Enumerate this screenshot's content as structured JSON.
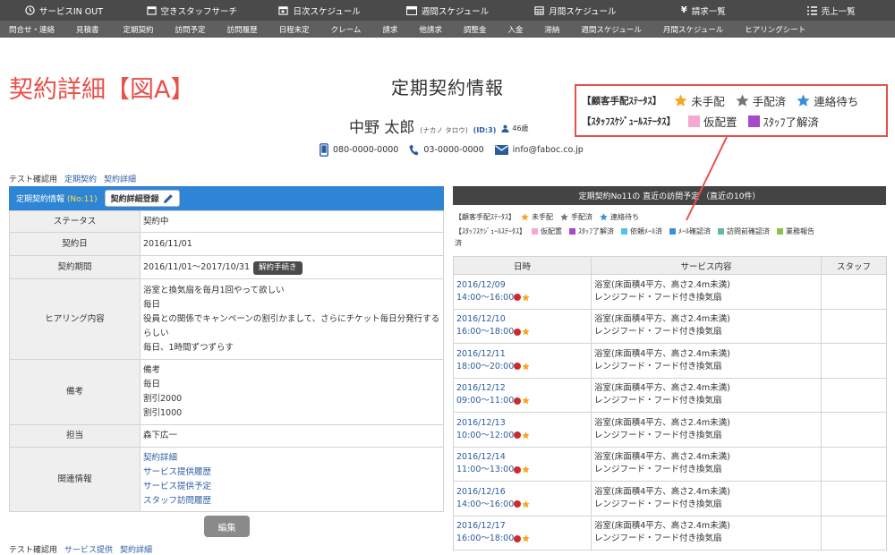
{
  "nav": {
    "top": [
      {
        "label": "サービスIN OUT",
        "icon": "clock-icon"
      },
      {
        "label": "空きスタッフサーチ",
        "icon": "calendar-icon"
      },
      {
        "label": "日次スケジュール",
        "icon": "calendar-icon"
      },
      {
        "label": "週間スケジュール",
        "icon": "week-icon"
      },
      {
        "label": "月間スケジュール",
        "icon": "calendar-icon"
      },
      {
        "label": "請求一覧",
        "icon": "yen-icon"
      },
      {
        "label": "売上一覧",
        "icon": "list-icon"
      }
    ],
    "sub": [
      "問合せ・連絡",
      "見積書",
      "定期契約",
      "訪問予定",
      "訪問履歴",
      "日程未定",
      "クレーム",
      "請求",
      "他請求",
      "調整金",
      "入金",
      "滞納",
      "週間スケジュール",
      "月間スケジュール",
      "ヒアリングシート"
    ]
  },
  "annotation": {
    "title": "契約詳細【図A】",
    "callout": {
      "customer_label": "【顧客手配ｽﾃｰﾀｽ】",
      "customer_items": [
        {
          "label": "未手配",
          "color": "#f5a623"
        },
        {
          "label": "手配済",
          "color": "#777777"
        },
        {
          "label": "連絡待ち",
          "color": "#3a8fd8"
        }
      ],
      "staff_label": "【ｽﾀｯﾌｽｹｼﾞｭｰﾙｽﾃｰﾀｽ】",
      "staff_items": [
        {
          "label": "仮配置",
          "color": "#f5a9d0"
        },
        {
          "label": "ｽﾀｯﾌ了解済",
          "color": "#a64ac9"
        }
      ]
    }
  },
  "page": {
    "title": "定期契約情報"
  },
  "customer": {
    "name": "中野 太郎",
    "kana": "(ナカノ タロウ)",
    "id": "(ID:3)",
    "age": "46歳",
    "mobile": "080-0000-0000",
    "phone": "03-0000-0000",
    "email": "info@faboc.co.jp"
  },
  "breadcrumb": {
    "prefix": "テスト確認用",
    "links": [
      "定期契約",
      "契約詳細"
    ]
  },
  "breadcrumb_bottom": {
    "prefix": "テスト確認用",
    "links": [
      "サービス提供",
      "契約詳細"
    ]
  },
  "contract": {
    "header_title": "定期契約情報",
    "header_no": "(No:11)",
    "register_button": "契約詳細登録",
    "status_label": "ステータス",
    "status": "契約中",
    "date_label": "契約日",
    "date": "2016/11/01",
    "period_label": "契約期間",
    "period": "2016/11/01～2017/10/31",
    "cancel_button": "解約手続き",
    "hearing_label": "ヒアリング内容",
    "hearing": [
      "浴室と換気扇を毎月1回やって欲しい",
      "毎日",
      "役員との関係でキャンペーンの割引かまして、さらにチケット毎日分発行する",
      "らしい",
      "毎日、1時間ずつずらす"
    ],
    "notes_label": "備考",
    "notes": [
      "備考",
      "毎日",
      "割引2000",
      "割引1000"
    ],
    "staff_label": "担当",
    "staff": "森下広一",
    "related_label": "関連情報",
    "related": [
      "契約詳細",
      "サービス提供履歴",
      "サービス提供予定",
      "スタッフ訪問履歴"
    ],
    "edit_button": "編集"
  },
  "visits": {
    "header": "定期契約No11の 直近の訪問予定 （直近の10件）",
    "legend_customer_label": "【顧客手配ｽﾃｰﾀｽ】",
    "legend_customer": [
      {
        "label": "未手配",
        "color": "#f5a623"
      },
      {
        "label": "手配済",
        "color": "#777777"
      },
      {
        "label": "連絡待ち",
        "color": "#3a8fd8"
      }
    ],
    "legend_staff_label": "【ｽﾀｯﾌｽｹｼﾞｭｰﾙｽﾃｰﾀｽ】",
    "legend_staff": [
      {
        "label": "仮配置",
        "color": "#f5a9d0"
      },
      {
        "label": "ｽﾀｯﾌ了解済",
        "color": "#a64ac9"
      },
      {
        "label": "依頼ﾒｰﾙ済",
        "color": "#4fc3e8"
      },
      {
        "label": "ﾒｰﾙ確認済",
        "color": "#3a8fd8"
      },
      {
        "label": "訪問前確認済",
        "color": "#5fb8a8"
      },
      {
        "label": "業務報告",
        "color": "#8bc34a"
      }
    ],
    "legend_wrap": "済",
    "columns": [
      "日時",
      "サービス内容",
      "スタッフ"
    ],
    "rows": [
      {
        "date": "2016/12/09",
        "time": "14:00～16:00",
        "line1": "浴室(床面積4平方、高さ2.4m未満)",
        "line2": "レンジフード・フード付き換気扇"
      },
      {
        "date": "2016/12/10",
        "time": "16:00～18:00",
        "line1": "浴室(床面積4平方、高さ2.4m未満)",
        "line2": "レンジフード・フード付き換気扇"
      },
      {
        "date": "2016/12/11",
        "time": "18:00～20:00",
        "line1": "浴室(床面積4平方、高さ2.4m未満)",
        "line2": "レンジフード・フード付き換気扇"
      },
      {
        "date": "2016/12/12",
        "time": "09:00～11:00",
        "line1": "浴室(床面積4平方、高さ2.4m未満)",
        "line2": "レンジフード・フード付き換気扇"
      },
      {
        "date": "2016/12/13",
        "time": "10:00～12:00",
        "line1": "浴室(床面積4平方、高さ2.4m未満)",
        "line2": "レンジフード・フード付き換気扇"
      },
      {
        "date": "2016/12/14",
        "time": "11:00～13:00",
        "line1": "浴室(床面積4平方、高さ2.4m未満)",
        "line2": "レンジフード・フード付き換気扇"
      },
      {
        "date": "2016/12/16",
        "time": "14:00～16:00",
        "line1": "浴室(床面積4平方、高さ2.4m未満)",
        "line2": "レンジフード・フード付き換気扇"
      },
      {
        "date": "2016/12/17",
        "time": "16:00～18:00",
        "line1": "浴室(床面積4平方、高さ2.4m未満)",
        "line2": "レンジフード・フード付き換気扇"
      }
    ]
  }
}
